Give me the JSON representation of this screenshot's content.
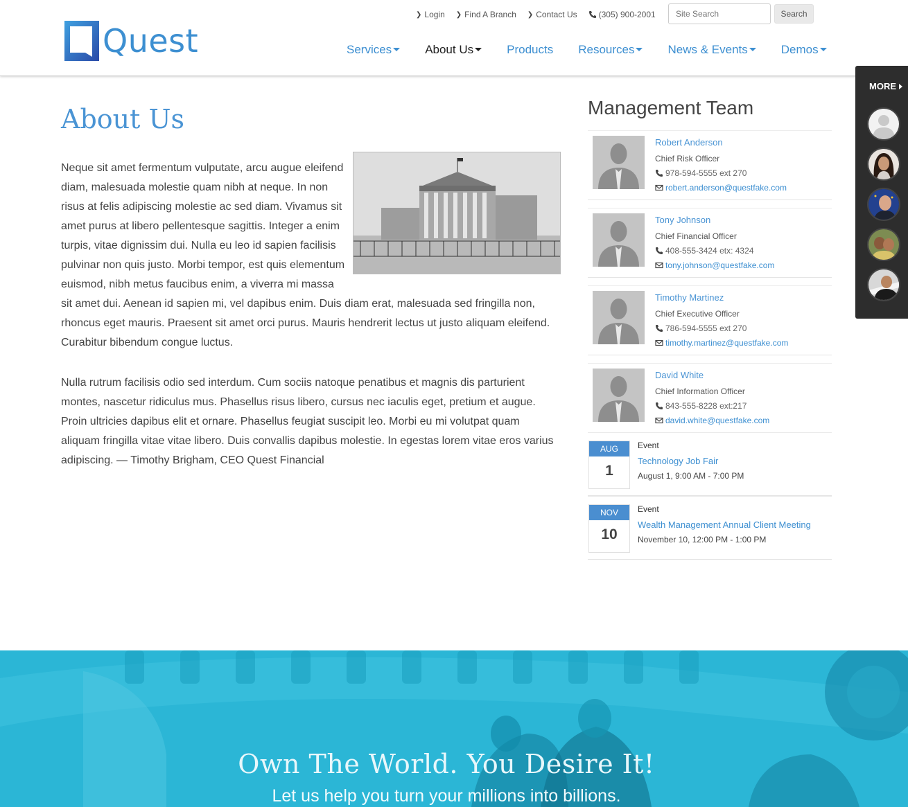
{
  "header": {
    "logo_text": "Quest",
    "utility_links": [
      {
        "label": "Login"
      },
      {
        "label": "Find A Branch"
      },
      {
        "label": "Contact Us"
      }
    ],
    "phone": "(305) 900-2001",
    "search": {
      "placeholder": "Site Search",
      "button_label": "Search"
    },
    "nav": [
      {
        "label": "Services",
        "has_dropdown": true
      },
      {
        "label": "About Us",
        "has_dropdown": true,
        "active": true
      },
      {
        "label": "Products",
        "has_dropdown": false
      },
      {
        "label": "Resources",
        "has_dropdown": true
      },
      {
        "label": "News & Events",
        "has_dropdown": true
      },
      {
        "label": "Demos",
        "has_dropdown": true
      }
    ]
  },
  "main": {
    "title": "About Us",
    "paragraph1": "Neque sit amet fermentum vulputate, arcu augue eleifend diam, malesuada molestie quam nibh at neque. In non risus at felis adipiscing molestie ac sed diam. Vivamus sit amet purus at libero pellentesque sagittis. Integer a enim turpis, vitae dignissim dui. Nulla eu leo id sapien facilisis pulvinar non quis justo. Morbi tempor, est quis elementum euismod, nibh metus faucibus enim, a viverra mi massa sit amet dui. Aenean id sapien mi, vel dapibus enim. Duis diam erat, malesuada sed fringilla non, rhoncus eget mauris. Praesent sit amet orci purus. Mauris hendrerit lectus ut justo aliquam eleifend. Curabitur bibendum congue luctus.",
    "paragraph2": "Nulla rutrum facilisis odio sed interdum. Cum sociis natoque penatibus et magnis dis parturient montes, nascetur ridiculus mus. Phasellus risus libero, cursus nec iaculis eget, pretium et augue. Proin ultricies dapibus elit et ornare. Phasellus feugiat suscipit leo. Morbi eu mi volutpat quam aliquam fringilla vitae vitae libero. Duis convallis dapibus molestie. In egestas lorem vitae eros varius adipiscing. — Timothy Brigham, CEO Quest Financial"
  },
  "sidebar": {
    "title": "Management Team",
    "team": [
      {
        "name": "Robert Anderson",
        "role": "Chief Risk Officer",
        "phone": "978-594-5555 ext 270",
        "email": "robert.anderson@questfake.com"
      },
      {
        "name": "Tony Johnson",
        "role": "Chief Financial Officer",
        "phone": "408-555-3424 etx: 4324",
        "email": "tony.johnson@questfake.com"
      },
      {
        "name": "Timothy Martinez",
        "role": "Chief Executive Officer",
        "phone": "786-594-5555 ext 270",
        "email": "timothy.martinez@questfake.com"
      },
      {
        "name": "David White",
        "role": "Chief Information Officer",
        "phone": "843-555-8228 ext:217",
        "email": "david.white@questfake.com"
      }
    ],
    "events": [
      {
        "month": "AUG",
        "day": "1",
        "type": "Event",
        "title": "Technology Job Fair",
        "time": "August 1, 9:00 AM - 7:00 PM"
      },
      {
        "month": "NOV",
        "day": "10",
        "type": "Event",
        "title": "Wealth Management Annual Client Meeting",
        "time": "November 10, 12:00 PM - 1:00 PM"
      }
    ]
  },
  "more_panel": {
    "label": "MORE"
  },
  "hero": {
    "title": "Own The World. You Desire It!",
    "subtitle": "Let us help you turn your millions into billions."
  },
  "colors": {
    "brand_blue": "#3d8fd1",
    "hero_cyan": "#2bb6d6",
    "panel_dark": "#2d2d2d"
  }
}
